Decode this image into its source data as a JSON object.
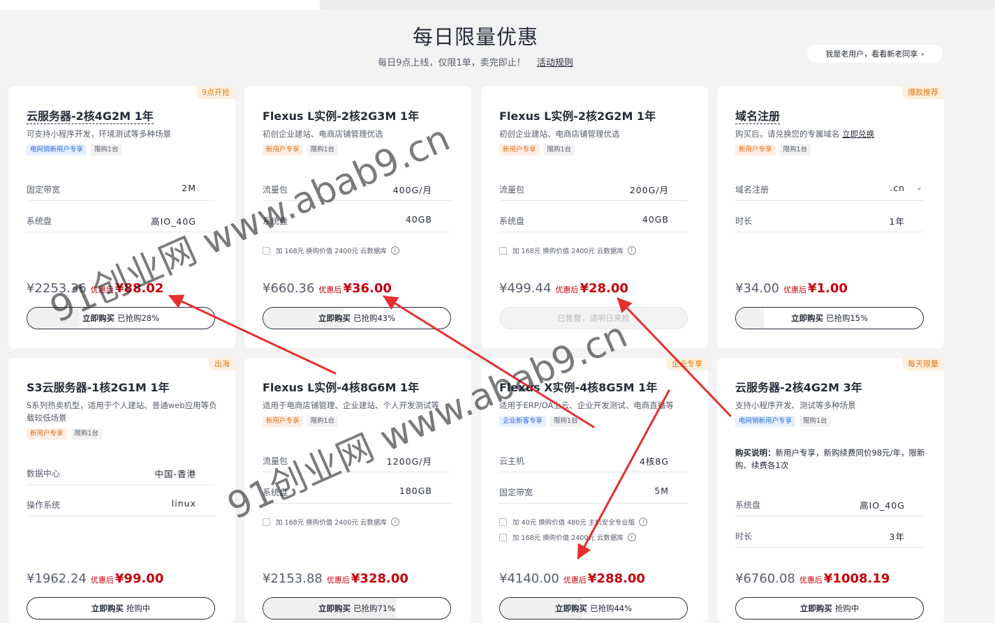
{
  "header": {
    "title": "每日限量优惠",
    "subtitle": "每日9点上线，仅限1单，卖完即止！",
    "rules_link": "活动规则",
    "old_user_button": "我是老用户，看看新老同享",
    "old_user_chevron": "›"
  },
  "labels": {
    "after_discount": "优惠后"
  },
  "colors": {
    "price_red": "#c7000b",
    "corner_orange": "#e07a1a",
    "tag_blue": "#2b6de0"
  },
  "cards": [
    {
      "corner": "9点开抢",
      "title": "云服务器-2核4G2M 1年",
      "desc": "可支持小程序开发，环境测试等多种场景",
      "tags": [
        "电网销新用户专享",
        "限购1台"
      ],
      "specs": [
        {
          "key": "固定带宽",
          "value": "2M"
        },
        {
          "key": "系统盘",
          "value": "高IO_40G"
        }
      ],
      "addons": [],
      "original_price": "¥2253.36",
      "price": "¥88.02",
      "buy_label": "立即购买",
      "buy_status": "已抢购28%",
      "progress_pct": 28
    },
    {
      "corner": "",
      "title": "Flexus L实例-2核2G3M 1年",
      "desc": "初创企业建站、电商店铺管理优选",
      "tags": [
        "新用户专享",
        "限购1台"
      ],
      "specs": [
        {
          "key": "流量包",
          "value": "400G/月"
        },
        {
          "key": "系统盘",
          "value": "40GB"
        }
      ],
      "addons": [
        "加 168元 换购价值 2400元 云数据库"
      ],
      "original_price": "¥660.36",
      "price": "¥36.00",
      "buy_label": "立即购买",
      "buy_status": "已抢购43%",
      "progress_pct": 43
    },
    {
      "corner": "",
      "title": "Flexus L实例-2核2G2M 1年",
      "desc": "初创企业建站、电商店铺管理优选",
      "tags": [
        "新用户专享",
        "限购1台"
      ],
      "specs": [
        {
          "key": "流量包",
          "value": "200G/月"
        },
        {
          "key": "系统盘",
          "value": "40GB"
        }
      ],
      "addons": [
        "加 168元 换购价值 2400元 云数据库"
      ],
      "original_price": "¥499.44",
      "price": "¥28.00",
      "buy_label": "已售罄，请明日来抢",
      "buy_status": "",
      "progress_pct": 100
    },
    {
      "corner": "爆款推荐",
      "title": "域名注册",
      "desc": "购买后，请兑换您的专属域名",
      "desc_link": "立即兑换",
      "tags": [
        "新用户专享",
        "限购1台"
      ],
      "specs": [
        {
          "key": "域名注册",
          "value": ".cn",
          "dropdown": "⌄"
        },
        {
          "key": "时长",
          "value": "1年"
        }
      ],
      "addons": [],
      "original_price": "¥34.00",
      "price": "¥1.00",
      "buy_label": "立即购买",
      "buy_status": "已抢购15%",
      "progress_pct": 15
    },
    {
      "corner": "出海",
      "title": "S3云服务器-1核2G1M 1年",
      "desc": "S系列热卖机型，适用于个人建站、普通web应用等负载较低场景",
      "tags": [
        "新用户专享",
        "限购1台"
      ],
      "specs": [
        {
          "key": "数据中心",
          "value": "中国-香港"
        },
        {
          "key": "操作系统",
          "value": "linux"
        }
      ],
      "addons": [],
      "original_price": "¥1962.24",
      "price": "¥99.00",
      "buy_label": "立即购买",
      "buy_status": "抢购中",
      "progress_pct": 0
    },
    {
      "corner": "",
      "title": "Flexus L实例-4核8G6M 1年",
      "desc": "适用于电商店铺管理、企业建站、个人开发测试等",
      "tags": [
        "新用户专享",
        "限购1台"
      ],
      "specs": [
        {
          "key": "流量包",
          "value": "1200G/月"
        },
        {
          "key": "系统盘",
          "value": "180GB"
        }
      ],
      "addons": [
        "加 168元 换购价值 2400元 云数据库"
      ],
      "original_price": "¥2153.88",
      "price": "¥328.00",
      "buy_label": "立即购买",
      "buy_status": "已抢购71%",
      "progress_pct": 71
    },
    {
      "corner": "企业专享",
      "title": "Flexus X实例-4核8G5M 1年",
      "desc": "适用于ERP/OA上云、企业开发测试、电商直播等",
      "tags": [
        "企业新客专享",
        "限购1台"
      ],
      "specs": [
        {
          "key": "云主机",
          "value": "4核8G"
        },
        {
          "key": "固定带宽",
          "value": "5M"
        }
      ],
      "addons": [
        "加 40元 换购价值 480元 主机安全专业版",
        "加 168元 换购价值 2400元 云数据库"
      ],
      "original_price": "¥4140.00",
      "price": "¥288.00",
      "buy_label": "立即购买",
      "buy_status": "已抢购44%",
      "progress_pct": 44
    },
    {
      "corner": "每天限量",
      "title": "云服务器-2核4G2M 3年",
      "desc": "支持小程序开发、测试等多种场景",
      "tags": [
        "电网销新用户专享",
        "限购1台"
      ],
      "note_label": "购买说明：",
      "note": "新用户专享，新购续费同价98元/年，限新购、续费各1次",
      "specs": [
        {
          "key": "系统盘",
          "value": "高IO_40G"
        },
        {
          "key": "时长",
          "value": "3年"
        }
      ],
      "addons": [],
      "original_price": "¥6760.08",
      "price": "¥1008.19",
      "buy_label": "立即购买",
      "buy_status": "抢购中",
      "progress_pct": 0
    }
  ],
  "watermarks": [
    "91创业网 www.abab9.cn",
    "91创业网 www.abab9.cn"
  ]
}
